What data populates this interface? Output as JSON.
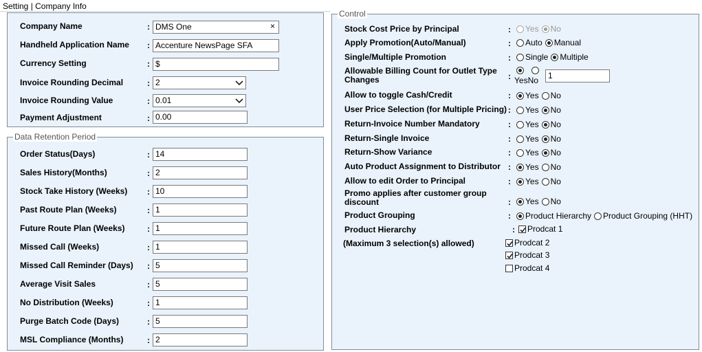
{
  "breadcrumb": "Setting | Company Info",
  "company": {
    "rows": [
      {
        "label": "Company Name",
        "value": "DMS One",
        "type": "text-clear"
      },
      {
        "label": "Handheld Application Name",
        "value": "Accenture NewsPage SFA",
        "type": "text"
      },
      {
        "label": "Currency Setting",
        "value": "$",
        "type": "text"
      },
      {
        "label": "Invoice Rounding Decimal",
        "value": "2",
        "type": "select"
      },
      {
        "label": "Invoice Rounding Value",
        "value": "0.01",
        "type": "select"
      },
      {
        "label": "Payment Adjustment",
        "value": "0.00",
        "type": "text"
      }
    ],
    "clear_glyph": "×"
  },
  "retention": {
    "legend": "Data Retention Period",
    "rows": [
      {
        "label": "Order Status(Days)",
        "value": "14"
      },
      {
        "label": "Sales History(Months)",
        "value": "2"
      },
      {
        "label": "Stock Take History (Weeks)",
        "value": "10"
      },
      {
        "label": "Past Route Plan (Weeks)",
        "value": "1"
      },
      {
        "label": "Future Route Plan (Weeks)",
        "value": "1"
      },
      {
        "label": "Missed Call (Weeks)",
        "value": "1"
      },
      {
        "label": "Missed Call Reminder (Days)",
        "value": "5"
      },
      {
        "label": "Average Visit Sales",
        "value": "5"
      },
      {
        "label": "No Distribution (Weeks)",
        "value": "1"
      },
      {
        "label": "Purge Batch Code (Days)",
        "value": "5"
      },
      {
        "label": "MSL Compliance (Months)",
        "value": "2"
      }
    ]
  },
  "control": {
    "legend": "Control",
    "rows": [
      {
        "label": "Stock Cost Price by Principal",
        "opt1": "Yes",
        "opt2": "No"
      },
      {
        "label": "Apply Promotion(Auto/Manual)",
        "opt1": "Auto",
        "opt2": "Manual"
      },
      {
        "label": "Single/Multiple Promotion",
        "opt1": "Single",
        "opt2": "Multiple"
      },
      {
        "label1": "Allowable Billing Count for Outlet Type",
        "label2": "Changes",
        "opt1": "Yes",
        "opt2": "No",
        "value": "1"
      },
      {
        "label": "Allow to toggle Cash/Credit",
        "opt1": "Yes",
        "opt2": "No"
      },
      {
        "label": "User Price Selection (for Multiple Pricing)",
        "opt1": "Yes",
        "opt2": "No"
      },
      {
        "label": "Return-Invoice Number Mandatory",
        "opt1": "Yes",
        "opt2": "No"
      },
      {
        "label": "Return-Single Invoice",
        "opt1": "Yes",
        "opt2": "No"
      },
      {
        "label": "Return-Show Variance",
        "opt1": "Yes",
        "opt2": "No"
      },
      {
        "label": "Auto Product Assignment to Distributor",
        "opt1": "Yes",
        "opt2": "No"
      },
      {
        "label": "Allow to edit Order to Principal",
        "opt1": "Yes",
        "opt2": "No"
      },
      {
        "label1": "Promo applies after customer group",
        "label2": "discount",
        "opt1": "Yes",
        "opt2": "No"
      },
      {
        "label": "Product Grouping",
        "opt1": "Product Hierarchy",
        "opt2": "Product Grouping (HHT)"
      },
      {
        "label": "Product Hierarchy"
      },
      {
        "label": "(Maximum 3 selection(s) allowed)"
      }
    ],
    "prodcats": [
      "Prodcat 1",
      "Prodcat 2",
      "Prodcat 3",
      "Prodcat 4"
    ]
  },
  "colon": ":"
}
